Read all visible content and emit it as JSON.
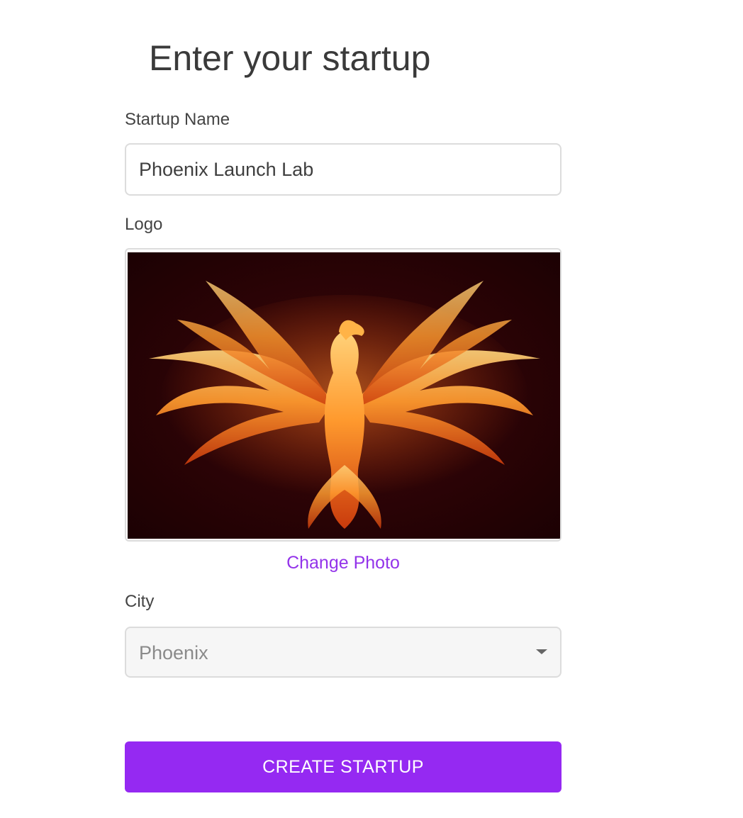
{
  "page": {
    "title": "Enter your startup"
  },
  "form": {
    "startup_name": {
      "label": "Startup Name",
      "value": "Phoenix Launch Lab"
    },
    "logo": {
      "label": "Logo",
      "image_description": "phoenix-logo",
      "change_label": "Change Photo"
    },
    "city": {
      "label": "City",
      "selected": "Phoenix"
    },
    "submit_label": "CREATE STARTUP"
  },
  "colors": {
    "accent": "#9529f2",
    "link": "#9333ea",
    "border": "#dcdcdc",
    "select_bg": "#f6f6f6"
  }
}
